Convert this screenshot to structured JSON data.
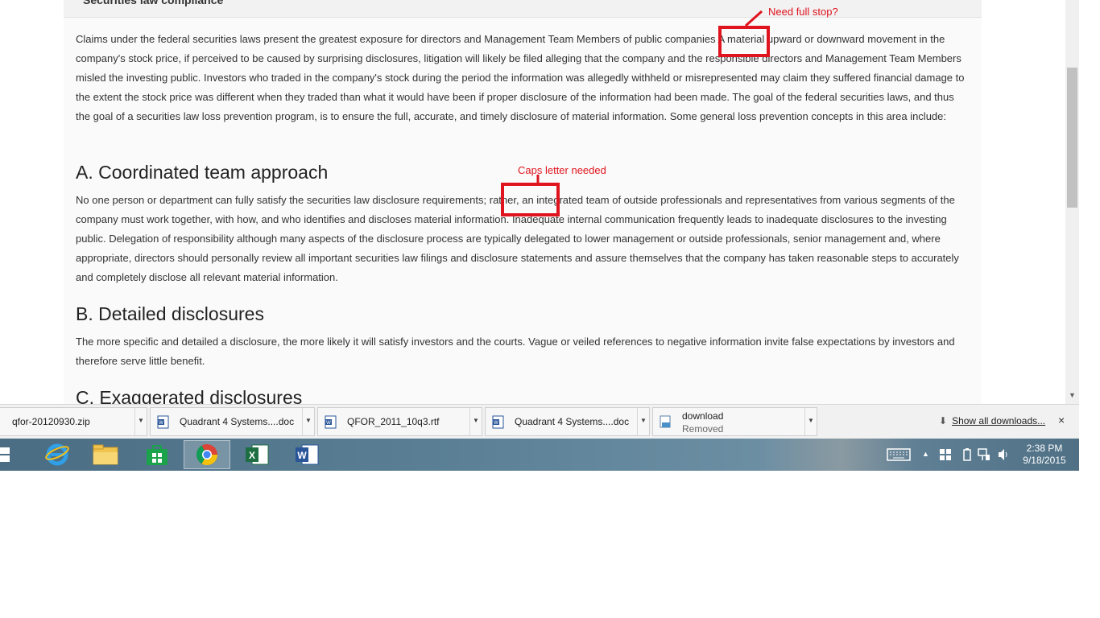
{
  "section": {
    "title": "Securities law compliance",
    "intro": "Claims under the federal securities laws present the greatest exposure for directors and Management Team Members of public companies A material upward or downward movement in the company's stock price, if perceived to be caused by surprising disclosures, litigation will likely be filed alleging that the company and the responsible directors and Management Team Members misled the investing public. Investors who traded in the company's stock during the period the information was allegedly withheld or misrepresented may claim they suffered financial damage to the extent the stock price was different when they traded than what it would have been if proper disclosure of the information had been made. The goal of the federal securities laws, and thus the goal of a securities law loss prevention program, is to ensure the full, accurate, and timely disclosure of material information. Some general loss prevention concepts in this area include:",
    "heading_a": "A. Coordinated team approach",
    "para_a": "No one person or department can fully satisfy the securities law disclosure requirements; rather, an integrated team of outside professionals and representatives from various segments of the company must work together, with how, and who identifies and discloses material information. Inadequate internal communication frequently leads to inadequate disclosures to the investing public. Delegation of responsibility although many aspects of the disclosure process are typically delegated to lower management or outside professionals, senior management and, where appropriate, directors should personally review all important securities law filings and disclosure statements and assure themselves that the company has taken reasonable steps to accurately and completely disclose all relevant material information.",
    "heading_b": "B. Detailed disclosures",
    "para_b": "The more specific and detailed a disclosure, the more likely it will satisfy investors and the courts. Vague or veiled references to negative information invite false expectations by investors and therefore serve little benefit.",
    "heading_c": "C. Exaggerated disclosures"
  },
  "annotations": {
    "note1": "Need full stop?",
    "note2": "Caps letter needed",
    "color": "#e0141e"
  },
  "downloads": {
    "items": [
      {
        "name": "qfor-20120930.zip",
        "icon": "zip-file-icon"
      },
      {
        "name": "Quadrant 4 Systems....doc",
        "icon": "word-doc-icon"
      },
      {
        "name": "QFOR_2011_10q3.rtf",
        "icon": "word-doc-icon"
      },
      {
        "name": "Quadrant 4 Systems....doc",
        "icon": "word-doc-icon"
      },
      {
        "name": "download",
        "status": "Removed",
        "icon": "generic-file-icon"
      }
    ],
    "show_all": "Show all downloads...",
    "close": "×"
  },
  "taskbar": {
    "apps": [
      "start-button",
      "internet-explorer-icon",
      "file-explorer-icon",
      "store-icon",
      "chrome-icon",
      "excel-icon",
      "word-icon"
    ],
    "active_app": "chrome-icon",
    "time": "2:38 PM",
    "date": "9/18/2015"
  }
}
